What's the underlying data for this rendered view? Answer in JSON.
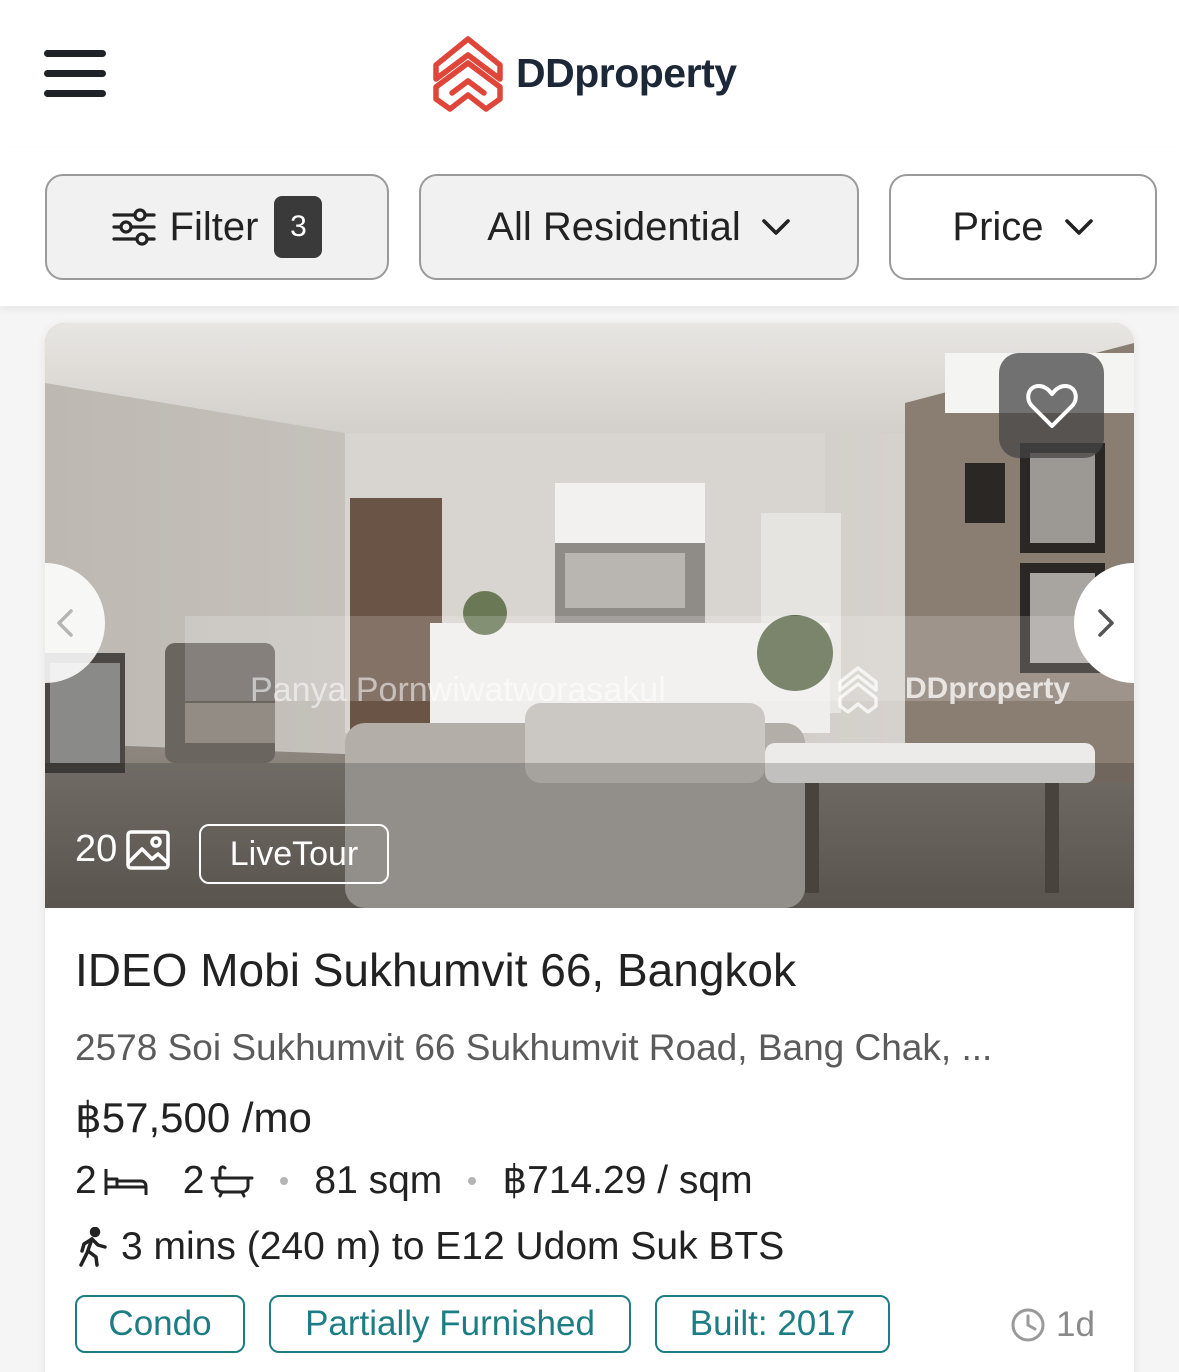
{
  "header": {
    "menu_icon": "hamburger-menu-icon",
    "logo_icon": "ddproperty-logo-icon",
    "brand": "DDproperty",
    "brand_color": "#e0453a"
  },
  "filters": {
    "filter_label": "Filter",
    "filter_count": "3",
    "property_type": "All Residential",
    "price_label": "Price"
  },
  "listing": {
    "photo_count": "20",
    "live_tour": "LiveTour",
    "title": "IDEO Mobi Sukhumvit 66, Bangkok",
    "address": "2578 Soi Sukhumvit 66 Sukhumvit Road, Bang Chak, ...",
    "price": "฿57,500 /mo",
    "beds": "2",
    "baths": "2",
    "area": "81 sqm",
    "price_per_sqm": "฿714.29 / sqm",
    "transit": "3 mins (240 m) to E12 Udom Suk BTS",
    "tags": [
      "Condo",
      "Partially Furnished",
      "Built: 2017"
    ],
    "posted": "1d",
    "watermark_agent": "Panya Pornwiwatworasakul",
    "watermark_brand": "DDproperty",
    "tag_color": "#1d7d84"
  }
}
